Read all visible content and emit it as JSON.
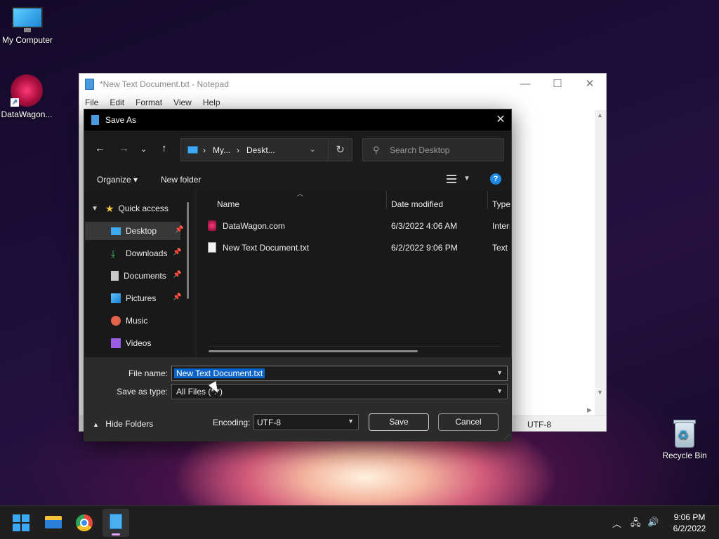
{
  "desktop": {
    "icons": [
      {
        "label": "My Computer"
      },
      {
        "label": "DataWagon..."
      },
      {
        "label": "Recycle Bin"
      }
    ]
  },
  "notepad": {
    "title": "*New Text Document.txt - Notepad",
    "menu": [
      "File",
      "Edit",
      "Format",
      "View",
      "Help"
    ],
    "status_encoding": "UTF-8",
    "window_controls": {
      "minimize": "—",
      "maximize": "☐",
      "close": "✕"
    }
  },
  "dialog": {
    "title": "Save As",
    "close": "✕",
    "nav": {
      "back": "←",
      "forward": "→",
      "recent": "⌄",
      "up": "↑"
    },
    "breadcrumb": [
      "My...",
      "Deskt..."
    ],
    "breadcrumb_sep": "›",
    "refresh": "↻",
    "search_placeholder": "Search Desktop",
    "toolbar": {
      "organize": "Organize ▾",
      "new_folder": "New folder",
      "help": "?"
    },
    "nav_pane": {
      "quick_access": "Quick access",
      "items": [
        {
          "label": "Desktop",
          "pinned": true,
          "selected": true
        },
        {
          "label": "Downloads",
          "pinned": true
        },
        {
          "label": "Documents",
          "pinned": true
        },
        {
          "label": "Pictures",
          "pinned": true
        },
        {
          "label": "Music",
          "pinned": false
        },
        {
          "label": "Videos",
          "pinned": false
        }
      ]
    },
    "columns": [
      "Name",
      "Date modified",
      "Type"
    ],
    "files": [
      {
        "name": "DataWagon.com",
        "date": "6/3/2022 4:06 AM",
        "type": "Internet Shortcut"
      },
      {
        "name": "New Text Document.txt",
        "date": "6/2/2022 9:06 PM",
        "type": "Text Document"
      }
    ],
    "file_name_label": "File name:",
    "file_name_value": "New Text Document.txt",
    "save_type_label": "Save as type:",
    "save_type_value": "All Files  (*.*)",
    "hide_folders": "Hide Folders",
    "encoding_label": "Encoding:",
    "encoding_value": "UTF-8",
    "save_button": "Save",
    "cancel_button": "Cancel"
  },
  "taskbar": {
    "time": "9:06 PM",
    "date": "6/2/2022",
    "tray": {
      "chevron": "︿",
      "network": "🖧",
      "volume": "🔊"
    }
  }
}
